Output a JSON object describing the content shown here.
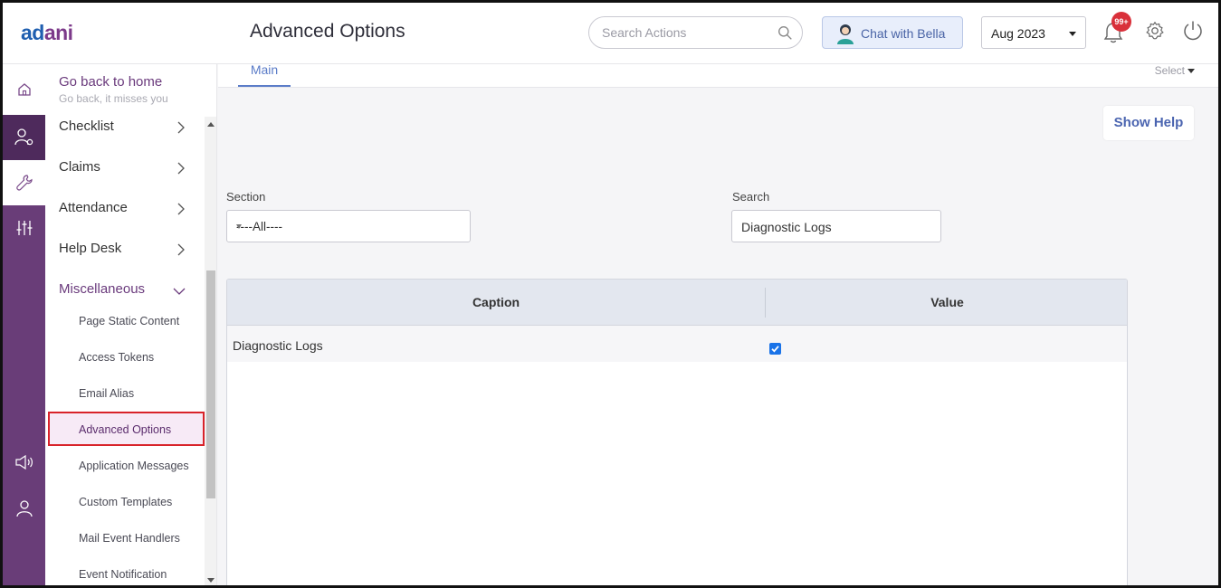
{
  "header": {
    "logo": "adani",
    "page_title": "Advanced Options",
    "search_placeholder": "Search Actions",
    "chat_label": "Chat with Bella",
    "month": "Aug 2023",
    "notification_badge": "99+"
  },
  "sidebar": {
    "goback_title": "Go back to home",
    "goback_subtitle": "Go back, it misses you",
    "items": [
      {
        "label": "Checklist"
      },
      {
        "label": "Claims"
      },
      {
        "label": "Attendance"
      },
      {
        "label": "Help Desk"
      },
      {
        "label": "Miscellaneous"
      }
    ],
    "subitems": [
      {
        "label": "Page Static Content"
      },
      {
        "label": "Access Tokens"
      },
      {
        "label": "Email Alias"
      },
      {
        "label": "Advanced Options"
      },
      {
        "label": "Application Messages"
      },
      {
        "label": "Custom Templates"
      },
      {
        "label": "Mail Event Handlers"
      },
      {
        "label": "Event Notification"
      }
    ]
  },
  "main": {
    "tab": "Main",
    "select_label": "Select",
    "show_help": "Show Help",
    "section_label": "Section",
    "section_value": "----All----",
    "search_label": "Search",
    "search_value": "Diagnostic Logs",
    "table": {
      "columns": [
        "Caption",
        "Value"
      ],
      "rows": [
        {
          "caption": "Diagnostic Logs",
          "checked": true
        }
      ]
    }
  },
  "colors": {
    "brand_purple": "#693d78",
    "accent_blue": "#5b7cc8",
    "badge_red": "#d9303a",
    "highlight_border": "#d8232a"
  }
}
